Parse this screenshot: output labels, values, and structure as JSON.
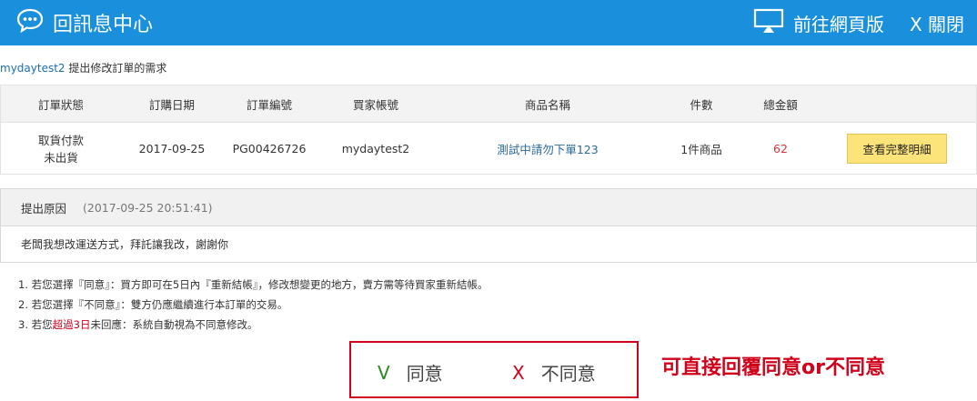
{
  "header": {
    "title": "回訊息中心",
    "webpage_label": "前往網頁版",
    "close_label": "X 關閉"
  },
  "request": {
    "user": "mydaytest2",
    "text": " 提出修改訂單的需求"
  },
  "table": {
    "headers": [
      "訂單狀態",
      "訂購日期",
      "訂單編號",
      "買家帳號",
      "商品名稱",
      "件數",
      "總金額",
      ""
    ],
    "row": {
      "status_line1": "取貨付款",
      "status_line2": "未出貨",
      "date": "2017-09-25",
      "order_no": "PG00426726",
      "buyer": "mydaytest2",
      "product": "測試中請勿下單123",
      "qty": "1件商品",
      "amount": "62",
      "detail_button": "查看完整明細"
    }
  },
  "reason": {
    "label": "提出原因",
    "time": "(2017-09-25 20:51:41)",
    "text": "老闆我想改運送方式，拜託讓我改，謝謝你"
  },
  "notes": {
    "n1": "1. 若您選擇『同意』：買方即可在5日內『重新結帳』，修改想變更的地方，賣方需等待買家重新結帳。",
    "n2": "2. 若您選擇『不同意』：雙方仍應繼續進行本訂單的交易。",
    "n3_pre": "3. 若您",
    "n3_hl": "超過3日",
    "n3_post": "未回應：系統自動視為不同意修改。"
  },
  "reply": {
    "agree_mark": "V",
    "agree_label": "同意",
    "disagree_mark": "X",
    "disagree_label": "不同意"
  },
  "annotation": "可直接回覆同意or不同意",
  "colors": {
    "header_bg": "#1a8fdc",
    "highlight_red": "#d0021b",
    "agree_green": "#2a8a22",
    "button_yellow": "#fde47a"
  },
  "icons": {
    "header": "chat-bubble-icon",
    "webpage": "monitor-icon"
  }
}
